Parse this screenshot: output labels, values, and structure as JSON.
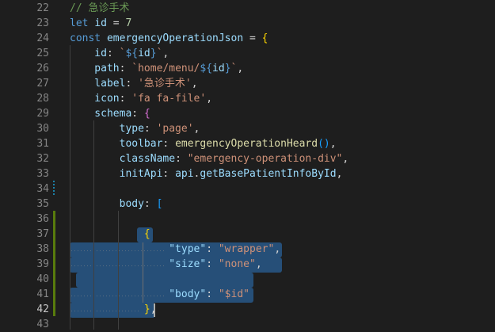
{
  "editor": {
    "lines": [
      {
        "num": "22",
        "tokens": [
          {
            "t": "// 急诊手术",
            "c": "c"
          }
        ]
      },
      {
        "num": "23",
        "tokens": [
          {
            "t": "let ",
            "c": "k"
          },
          {
            "t": "id",
            "c": "v"
          },
          {
            "t": " = ",
            "c": "p"
          },
          {
            "t": "7",
            "c": "n"
          }
        ]
      },
      {
        "num": "24",
        "tokens": [
          {
            "t": "const ",
            "c": "k"
          },
          {
            "t": "emergencyOperationJson",
            "c": "v"
          },
          {
            "t": " = ",
            "c": "p"
          },
          {
            "t": "{",
            "c": "b1"
          }
        ]
      },
      {
        "num": "25",
        "tokens": [
          {
            "t": "    id",
            "c": "v"
          },
          {
            "t": ": ",
            "c": "p"
          },
          {
            "t": "`",
            "c": "s"
          },
          {
            "t": "${",
            "c": "k"
          },
          {
            "t": "id",
            "c": "v"
          },
          {
            "t": "}",
            "c": "k"
          },
          {
            "t": "`",
            "c": "s"
          },
          {
            "t": ",",
            "c": "p"
          }
        ]
      },
      {
        "num": "26",
        "tokens": [
          {
            "t": "    path",
            "c": "v"
          },
          {
            "t": ": ",
            "c": "p"
          },
          {
            "t": "`home/menu/",
            "c": "s"
          },
          {
            "t": "${",
            "c": "k"
          },
          {
            "t": "id",
            "c": "v"
          },
          {
            "t": "}",
            "c": "k"
          },
          {
            "t": "`",
            "c": "s"
          },
          {
            "t": ",",
            "c": "p"
          }
        ]
      },
      {
        "num": "27",
        "tokens": [
          {
            "t": "    label",
            "c": "v"
          },
          {
            "t": ": ",
            "c": "p"
          },
          {
            "t": "'急诊手术'",
            "c": "s"
          },
          {
            "t": ",",
            "c": "p"
          }
        ]
      },
      {
        "num": "28",
        "tokens": [
          {
            "t": "    icon",
            "c": "v"
          },
          {
            "t": ": ",
            "c": "p"
          },
          {
            "t": "'fa fa-file'",
            "c": "s"
          },
          {
            "t": ",",
            "c": "p"
          }
        ]
      },
      {
        "num": "29",
        "tokens": [
          {
            "t": "    schema",
            "c": "v"
          },
          {
            "t": ": ",
            "c": "p"
          },
          {
            "t": "{",
            "c": "b2"
          }
        ]
      },
      {
        "num": "30",
        "tokens": [
          {
            "t": "        type",
            "c": "v"
          },
          {
            "t": ": ",
            "c": "p"
          },
          {
            "t": "'page'",
            "c": "s"
          },
          {
            "t": ",",
            "c": "p"
          }
        ]
      },
      {
        "num": "31",
        "tokens": [
          {
            "t": "        toolbar",
            "c": "v"
          },
          {
            "t": ": ",
            "c": "p"
          },
          {
            "t": "emergencyOperationHeard",
            "c": "f"
          },
          {
            "t": "()",
            "c": "b3"
          },
          {
            "t": ",",
            "c": "p"
          }
        ]
      },
      {
        "num": "32",
        "tokens": [
          {
            "t": "        className",
            "c": "v"
          },
          {
            "t": ": ",
            "c": "p"
          },
          {
            "t": "\"emergency-operation-div\"",
            "c": "s"
          },
          {
            "t": ",",
            "c": "p"
          }
        ]
      },
      {
        "num": "33",
        "tokens": [
          {
            "t": "        initApi",
            "c": "v"
          },
          {
            "t": ": ",
            "c": "p"
          },
          {
            "t": "api",
            "c": "v"
          },
          {
            "t": ".",
            "c": "p"
          },
          {
            "t": "getBasePatientInfoById",
            "c": "v"
          },
          {
            "t": ",",
            "c": "p"
          }
        ]
      },
      {
        "num": "34",
        "tokens": []
      },
      {
        "num": "35",
        "tokens": [
          {
            "t": "        body",
            "c": "v"
          },
          {
            "t": ": ",
            "c": "p"
          },
          {
            "t": "[",
            "c": "b3"
          }
        ]
      },
      {
        "num": "36",
        "tokens": []
      },
      {
        "num": "37",
        "tokens": [
          {
            "t": "            ",
            "c": "p"
          },
          {
            "t": "{",
            "c": "b1"
          }
        ]
      },
      {
        "num": "38",
        "tokens": [
          {
            "t": "                ",
            "c": "p"
          },
          {
            "t": "\"type\"",
            "c": "v"
          },
          {
            "t": ": ",
            "c": "p"
          },
          {
            "t": "\"wrapper\"",
            "c": "s"
          },
          {
            "t": ",",
            "c": "p"
          }
        ]
      },
      {
        "num": "39",
        "tokens": [
          {
            "t": "                ",
            "c": "p"
          },
          {
            "t": "\"size\"",
            "c": "v"
          },
          {
            "t": ": ",
            "c": "p"
          },
          {
            "t": "\"none\"",
            "c": "s"
          },
          {
            "t": ",",
            "c": "p"
          }
        ]
      },
      {
        "num": "40",
        "tokens": []
      },
      {
        "num": "41",
        "tokens": [
          {
            "t": "                ",
            "c": "p"
          },
          {
            "t": "\"body\"",
            "c": "v"
          },
          {
            "t": ": ",
            "c": "p"
          },
          {
            "t": "\"$id\"",
            "c": "s"
          }
        ]
      },
      {
        "num": "42",
        "tokens": [
          {
            "t": "            ",
            "c": "p"
          },
          {
            "t": "}",
            "c": "b1"
          },
          {
            "t": ",",
            "c": "p"
          }
        ]
      },
      {
        "num": "43",
        "tokens": []
      }
    ],
    "active_line": "42",
    "colors": {
      "background": "#1e1e1e",
      "selection": "#264f78",
      "gutter_modified": "#587c0c",
      "gutter_changed": "#1b81a8"
    }
  }
}
